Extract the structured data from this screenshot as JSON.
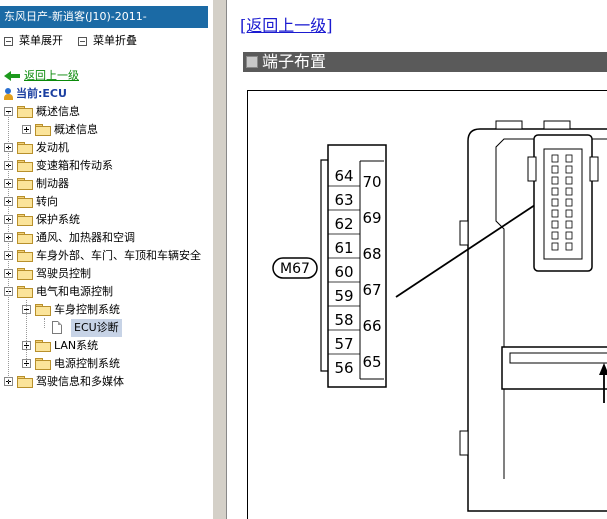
{
  "nav": {
    "title": "东风日产-新逍客(J10)-2011-",
    "expand_label": "菜单展开",
    "collapse_label": "菜单折叠",
    "back_label": "返回上一级",
    "current_label": "当前:ECU",
    "tree": [
      {
        "label": "概述信息",
        "level": 0,
        "expanded": true,
        "toggle": "minus"
      },
      {
        "label": "概述信息",
        "level": 1,
        "expanded": false,
        "toggle": "plus"
      },
      {
        "label": "发动机",
        "level": 0,
        "toggle": "plus"
      },
      {
        "label": "变速箱和传动系",
        "level": 0,
        "toggle": "plus"
      },
      {
        "label": "制动器",
        "level": 0,
        "toggle": "plus"
      },
      {
        "label": "转向",
        "level": 0,
        "toggle": "plus"
      },
      {
        "label": "保护系统",
        "level": 0,
        "toggle": "plus"
      },
      {
        "label": "通风、加热器和空调",
        "level": 0,
        "toggle": "plus"
      },
      {
        "label": "车身外部、车门、车顶和车辆安全",
        "level": 0,
        "toggle": "plus"
      },
      {
        "label": "驾驶员控制",
        "level": 0,
        "toggle": "plus"
      },
      {
        "label": "电气和电源控制",
        "level": 0,
        "expanded": true,
        "toggle": "minus"
      },
      {
        "label": "车身控制系统",
        "level": 1,
        "expanded": true,
        "toggle": "minus"
      },
      {
        "label": "ECU诊断",
        "level": 2,
        "selected": true,
        "toggle": "none"
      },
      {
        "label": "LAN系统",
        "level": 1,
        "toggle": "plus"
      },
      {
        "label": "电源控制系统",
        "level": 1,
        "toggle": "plus"
      },
      {
        "label": "驾驶信息和多媒体",
        "level": 0,
        "toggle": "plus"
      }
    ]
  },
  "content": {
    "back_link": "[返回上一级]",
    "section_title": "端子布置",
    "connector": {
      "name": "M67",
      "left_pins": [
        "64",
        "63",
        "62",
        "61",
        "60",
        "59",
        "58",
        "57",
        "56"
      ],
      "right_pins": [
        "70",
        "69",
        "68",
        "67",
        "66",
        "65"
      ]
    }
  },
  "colors": {
    "title_bar": "#1b6aa5",
    "section_header": "#5a5a5a",
    "link": "#1b1bd0",
    "back_green": "#0a8a0a"
  }
}
